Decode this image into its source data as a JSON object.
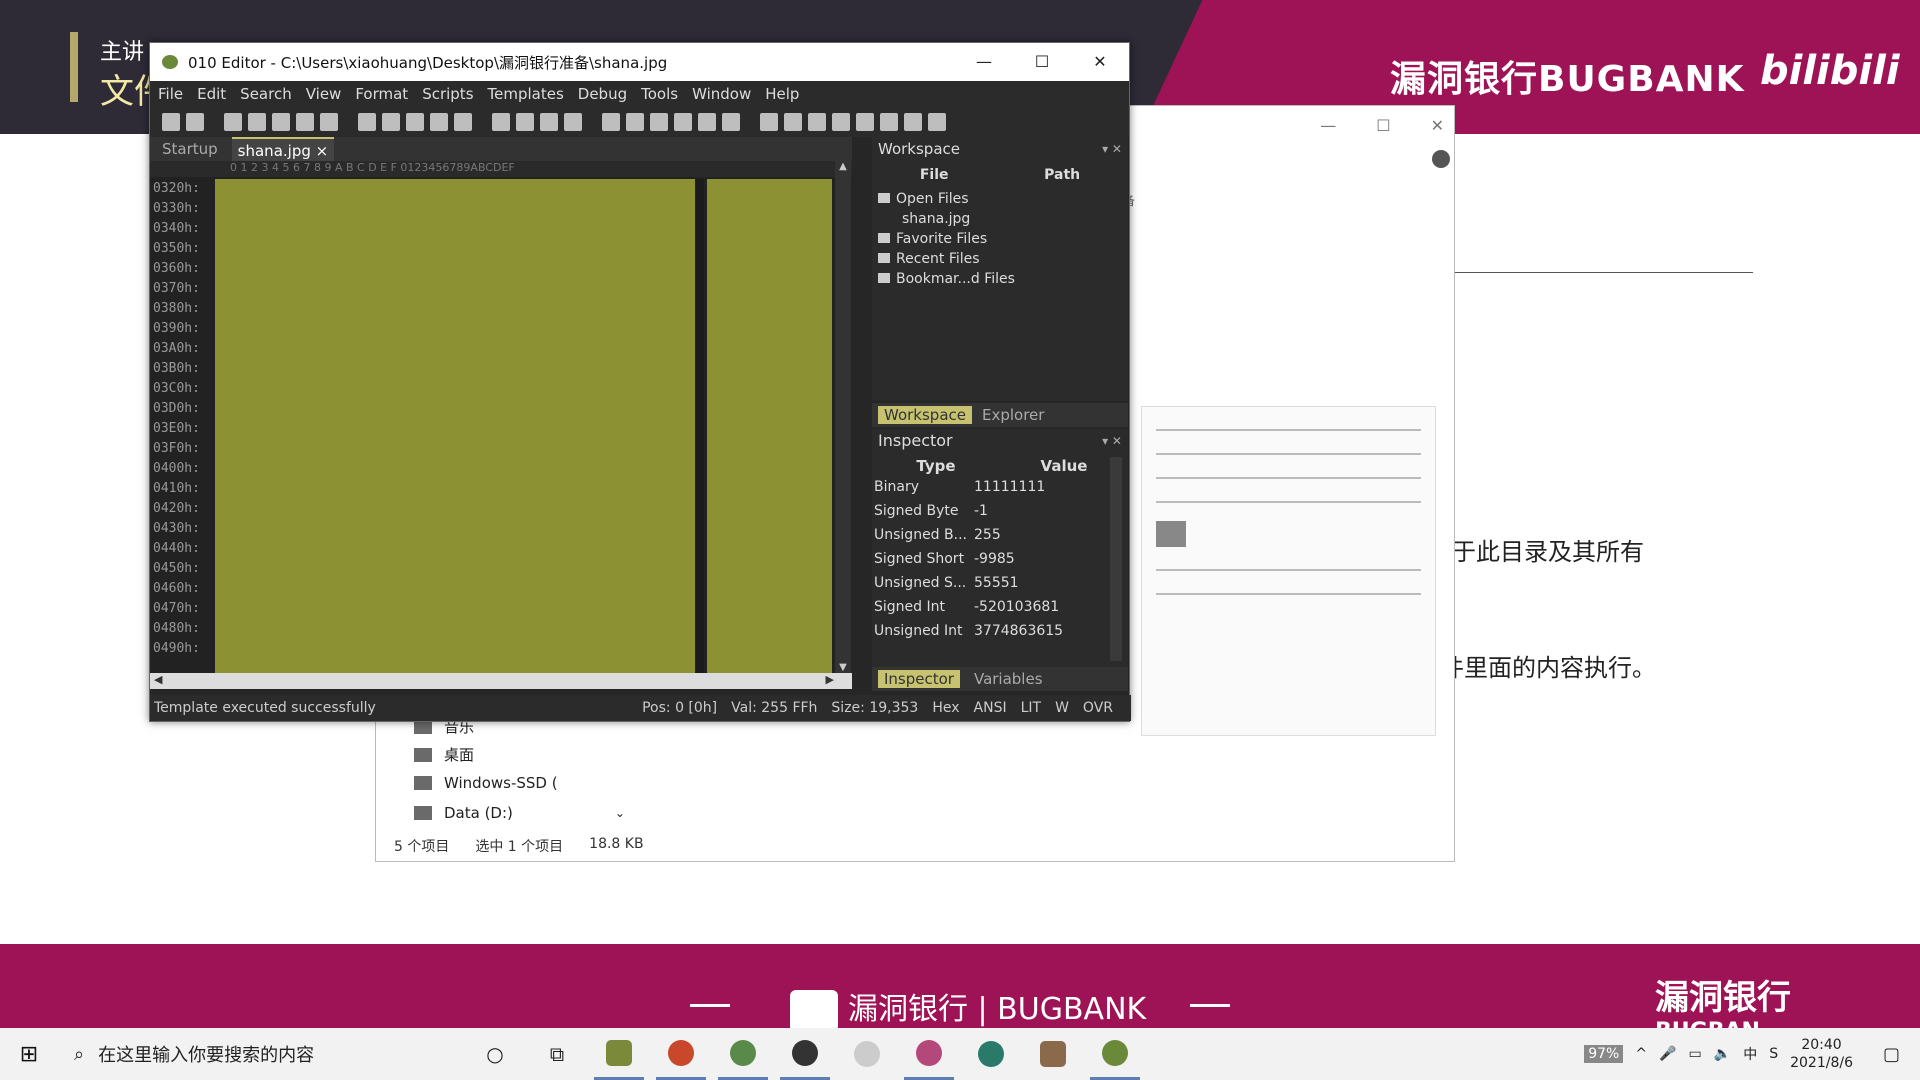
{
  "slide": {
    "presenter_line": "主讲",
    "title_fragment": "文件",
    "brand_top": "漏洞银行BUGBANK",
    "bilibili": "bilibili",
    "text_line_1": "于此目录及其所有",
    "text_line_2": "件里面的内容执行。",
    "brand_bottom": "漏洞银行 | BUGBANK",
    "brand_bottom_right": "漏洞银行",
    "brand_bottom_right_sub": "BUGBAN"
  },
  "explorer": {
    "tree": [
      {
        "label": "音乐",
        "icon": "music-folder-icon"
      },
      {
        "label": "桌面",
        "icon": "desktop-folder-icon"
      },
      {
        "label": "Windows-SSD (",
        "icon": "drive-icon"
      },
      {
        "label": "Data (D:)",
        "icon": "drive-icon"
      }
    ],
    "status_count": "5 个项目",
    "status_selected": "选中 1 个项目",
    "status_size": "18.8 KB",
    "path_hint": "准备"
  },
  "editor": {
    "title": "010 Editor - C:\\Users\\xiaohuang\\Desktop\\漏洞银行准备\\shana.jpg",
    "menu": [
      "File",
      "Edit",
      "Search",
      "View",
      "Format",
      "Scripts",
      "Templates",
      "Debug",
      "Tools",
      "Window",
      "Help"
    ],
    "tabs": [
      {
        "label": "Startup",
        "active": false
      },
      {
        "label": "shana.jpg",
        "active": true
      }
    ],
    "hex_header": "0  1  2  3  4  5  6  7  8  9  A  B  C  D  E  F    0123456789ABCDEF",
    "addresses": [
      "0320h:",
      "0330h:",
      "0340h:",
      "0350h:",
      "0360h:",
      "0370h:",
      "0380h:",
      "0390h:",
      "03A0h:",
      "03B0h:",
      "03C0h:",
      "03D0h:",
      "03E0h:",
      "03F0h:",
      "0400h:",
      "0410h:",
      "0420h:",
      "0430h:",
      "0440h:",
      "0450h:",
      "0460h:",
      "0470h:",
      "0480h:",
      "0490h:"
    ],
    "workspace": {
      "title": "Workspace",
      "col_file": "File",
      "col_path": "Path",
      "items": [
        {
          "label": "Open Files",
          "child": false
        },
        {
          "label": "shana.jpg",
          "child": true
        },
        {
          "label": "Favorite Files",
          "child": false
        },
        {
          "label": "Recent Files",
          "child": false
        },
        {
          "label": "Bookmar...d Files",
          "child": false
        }
      ],
      "tab_workspace": "Workspace",
      "tab_explorer": "Explorer"
    },
    "inspector": {
      "title": "Inspector",
      "col_type": "Type",
      "col_value": "Value",
      "rows": [
        {
          "type": "Binary",
          "value": "11111111"
        },
        {
          "type": "Signed Byte",
          "value": "-1"
        },
        {
          "type": "Unsigned B...",
          "value": "255"
        },
        {
          "type": "Signed Short",
          "value": "-9985"
        },
        {
          "type": "Unsigned S...",
          "value": "55551"
        },
        {
          "type": "Signed Int",
          "value": "-520103681"
        },
        {
          "type": "Unsigned Int",
          "value": "3774863615"
        }
      ],
      "tab_inspector": "Inspector",
      "tab_variables": "Variables"
    },
    "status": {
      "message": "Template executed successfully",
      "pos": "Pos: 0 [0h]",
      "val": "Val: 255 FFh",
      "size": "Size: 19,353",
      "hex": "Hex",
      "ansi": "ANSI",
      "lit": "LIT",
      "w": "W",
      "ovr": "OVR"
    },
    "hex_fill_color": "#8c9133"
  },
  "taskbar": {
    "search_placeholder": "在这里输入你要搜索的内容",
    "time": "20:40",
    "date": "2021/8/6",
    "ime": "中",
    "battery": "97%"
  }
}
